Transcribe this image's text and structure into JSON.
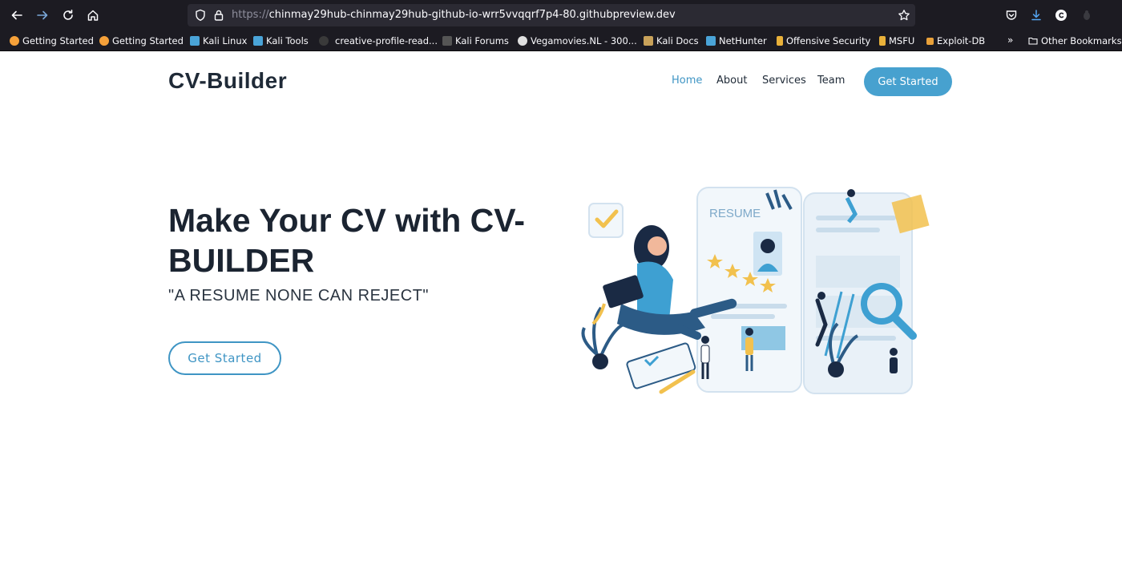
{
  "browser": {
    "url_scheme": "https://",
    "url_host": "chinmay29hub-chinmay29hub-github-io-wrr5vvqqrf7p4-80.githubpreview.dev",
    "bookmarks": [
      {
        "label": "Getting Started",
        "icon_color": "#f6a13a"
      },
      {
        "label": "Getting Started",
        "icon_color": "#f6a13a"
      },
      {
        "label": "Kali Linux",
        "icon_color": "#4aa4d8"
      },
      {
        "label": "Kali Tools",
        "icon_color": "#4aa4d8"
      },
      {
        "label": "creative-profile-read...",
        "icon_color": "#3a3a3a"
      },
      {
        "label": "Kali Forums",
        "icon_color": "#555555"
      },
      {
        "label": "Vegamovies.NL - 300...",
        "icon_color": "#e0e0e0"
      },
      {
        "label": "Kali Docs",
        "icon_color": "#c9a25a"
      },
      {
        "label": "NetHunter",
        "icon_color": "#4aa4d8"
      },
      {
        "label": "Offensive Security",
        "icon_color": "#e9b13a"
      },
      {
        "label": "MSFU",
        "icon_color": "#e9b13a"
      },
      {
        "label": "Exploit-DB",
        "icon_color": "#e9a13a"
      }
    ],
    "other_bookmarks": "Other Bookmarks"
  },
  "site": {
    "logo": "CV-Builder",
    "nav": {
      "home": "Home",
      "about": "About",
      "services": "Services",
      "team": "Team",
      "cta": "Get Started"
    },
    "hero": {
      "title": "Make Your CV with CV-BUILDER",
      "subtitle": "\"A RESUME NONE CAN REJECT\"",
      "button": "Get Started",
      "illustration_text": "RESUME"
    },
    "colors": {
      "accent": "#47a1cf",
      "heading": "#1b2431"
    }
  }
}
